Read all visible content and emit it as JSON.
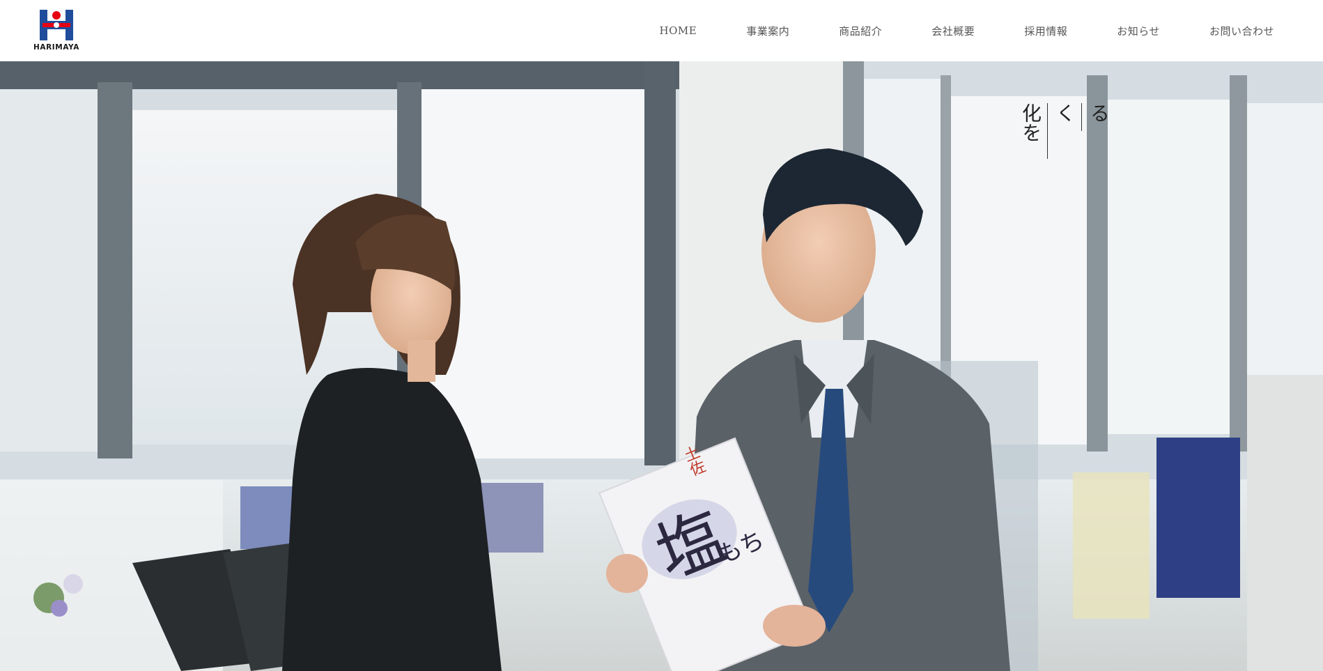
{
  "header": {
    "logo_text": "HARIMAYA",
    "nav": [
      {
        "label": "HOME"
      },
      {
        "label": "事業案内"
      },
      {
        "label": "商品紹介"
      },
      {
        "label": "会社概要"
      },
      {
        "label": "採用情報"
      },
      {
        "label": "お知らせ"
      },
      {
        "label": "お問い合わせ"
      }
    ]
  },
  "hero": {
    "catch_columns": [
      "化を",
      "く",
      "る"
    ],
    "package_label_main": "塩",
    "package_label_top": "土佐",
    "package_label_sub": "もち"
  },
  "colors": {
    "logo_blue": "#1f4d9b",
    "logo_red": "#e60012",
    "nav_text": "#555555"
  }
}
